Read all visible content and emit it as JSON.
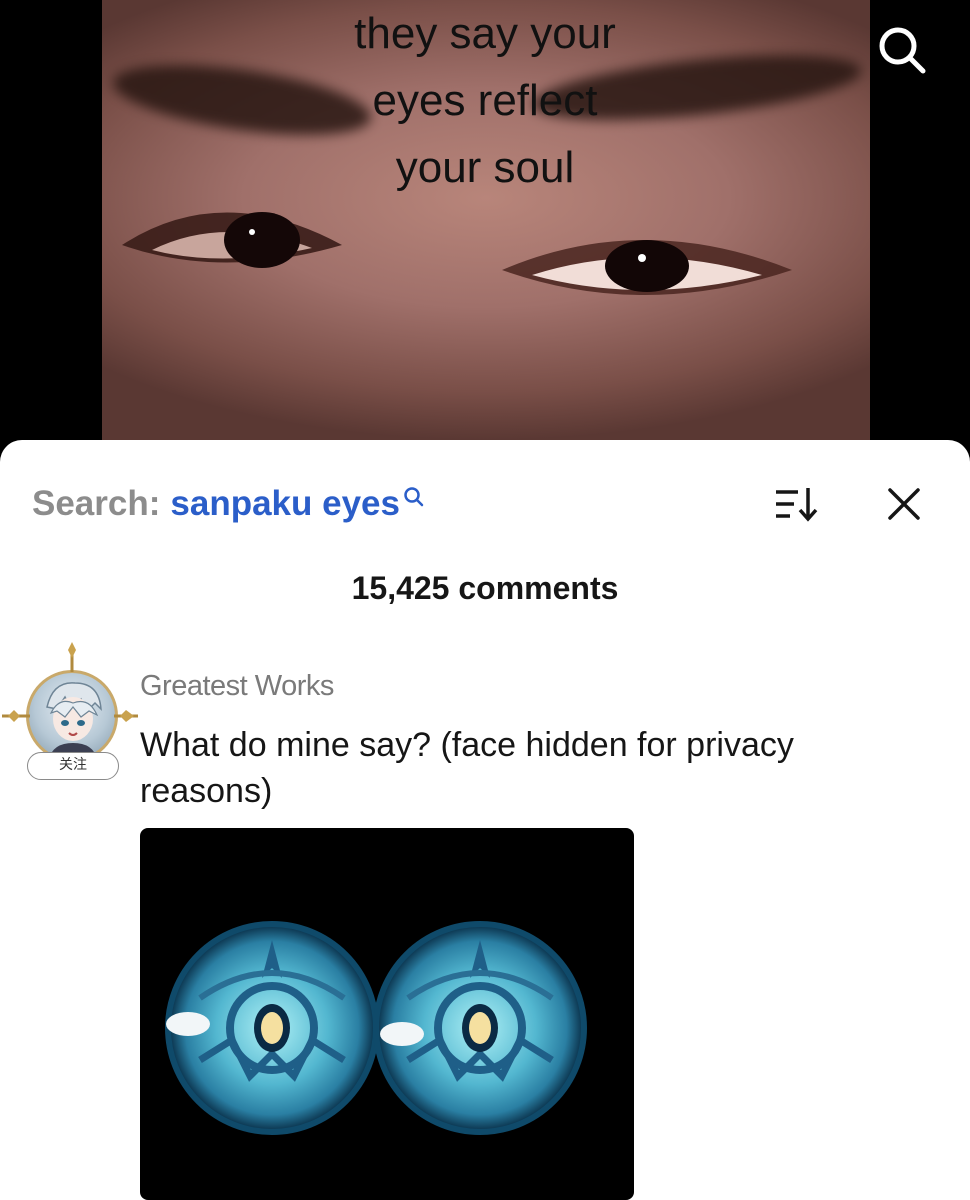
{
  "video": {
    "caption_lines": [
      "they say your",
      "eyes reflect",
      "your soul"
    ],
    "search_icon": "search-icon"
  },
  "comments_panel": {
    "search_label": "Search:",
    "search_term": "sanpaku eyes",
    "sort_icon": "sort-icon",
    "close_icon": "close-icon",
    "comment_count": "15,425 comments"
  },
  "comment": {
    "username": "Greatest Works",
    "follow_label": "关注",
    "text": "What do mine say? (face hidden for privacy reasons)"
  },
  "colors": {
    "search_term": "#2b5ec9",
    "label_gray": "#8c8c8c"
  }
}
